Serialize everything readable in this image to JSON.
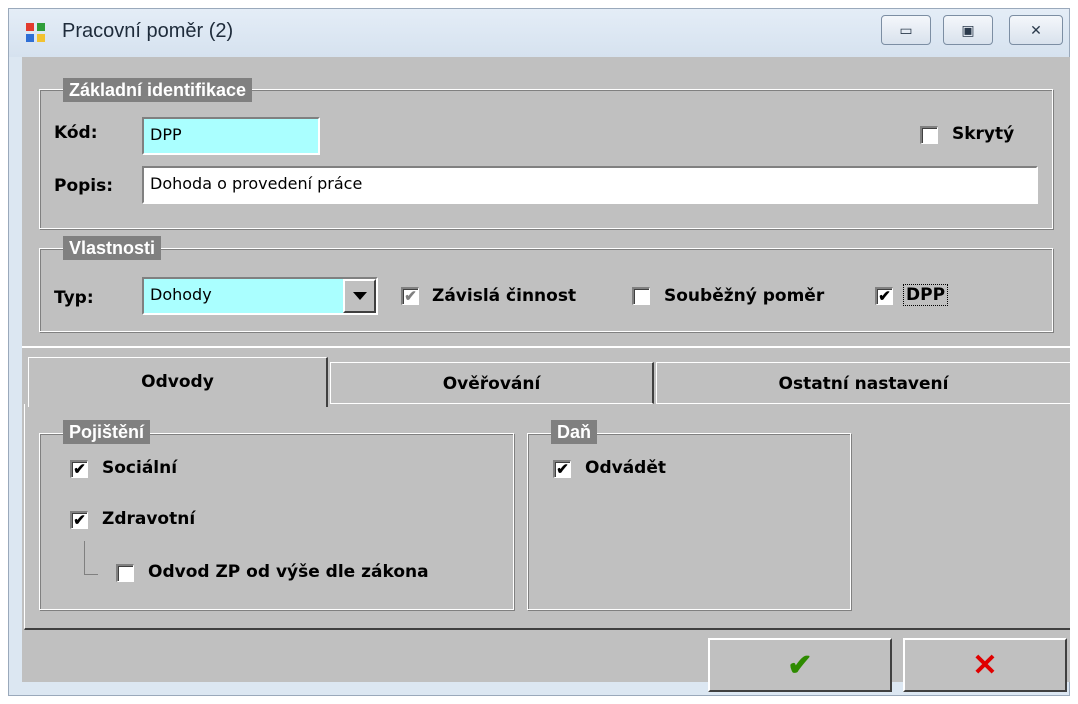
{
  "window": {
    "title": "Pracovní poměr (2)",
    "minimize_glyph": "▭",
    "maximize_glyph": "▣",
    "close_glyph": "✕"
  },
  "identification": {
    "legend": "Základní identifikace",
    "code_label": "Kód:",
    "code_value": "DPP",
    "description_label": "Popis:",
    "description_value": "Dohoda o provedení práce",
    "hidden_label": "Skrytý",
    "hidden_checked": false
  },
  "properties": {
    "legend": "Vlastnosti",
    "type_label": "Typ:",
    "type_value": "Dohody",
    "dependent_activity_label": "Závislá činnost",
    "dependent_activity_checked": true,
    "dependent_activity_enabled": false,
    "concurrent_label": "Souběžný poměr",
    "concurrent_checked": false,
    "dpp_label": "DPP",
    "dpp_checked": true
  },
  "tabs": [
    {
      "label": "Odvody",
      "active": true
    },
    {
      "label": "Ověřování",
      "active": false
    },
    {
      "label": "Ostatní nastavení",
      "active": false
    }
  ],
  "insurance": {
    "legend": "Pojištění",
    "social_label": "Sociální",
    "social_checked": true,
    "health_label": "Zdravotní",
    "health_checked": true,
    "health_by_law_label": "Odvod ZP od výše dle zákona",
    "health_by_law_checked": false
  },
  "tax": {
    "legend": "Daň",
    "withhold_label": "Odvádět",
    "withhold_checked": true
  },
  "buttons": {
    "ok_glyph": "✔",
    "cancel_glyph": "✕"
  },
  "colors": {
    "ok": "#2e8b00",
    "cancel": "#e00000",
    "required_field": "#aaffff"
  },
  "checkmark": "✔"
}
